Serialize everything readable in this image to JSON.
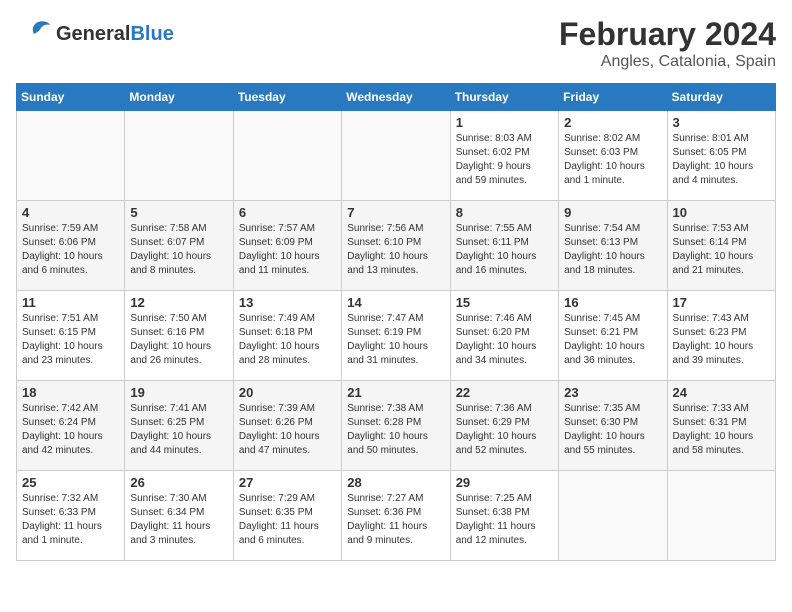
{
  "header": {
    "logo_general": "General",
    "logo_blue": "Blue",
    "month": "February 2024",
    "location": "Angles, Catalonia, Spain"
  },
  "days_of_week": [
    "Sunday",
    "Monday",
    "Tuesday",
    "Wednesday",
    "Thursday",
    "Friday",
    "Saturday"
  ],
  "weeks": [
    [
      {
        "day": "",
        "info": ""
      },
      {
        "day": "",
        "info": ""
      },
      {
        "day": "",
        "info": ""
      },
      {
        "day": "",
        "info": ""
      },
      {
        "day": "1",
        "info": "Sunrise: 8:03 AM\nSunset: 6:02 PM\nDaylight: 9 hours\nand 59 minutes."
      },
      {
        "day": "2",
        "info": "Sunrise: 8:02 AM\nSunset: 6:03 PM\nDaylight: 10 hours\nand 1 minute."
      },
      {
        "day": "3",
        "info": "Sunrise: 8:01 AM\nSunset: 6:05 PM\nDaylight: 10 hours\nand 4 minutes."
      }
    ],
    [
      {
        "day": "4",
        "info": "Sunrise: 7:59 AM\nSunset: 6:06 PM\nDaylight: 10 hours\nand 6 minutes."
      },
      {
        "day": "5",
        "info": "Sunrise: 7:58 AM\nSunset: 6:07 PM\nDaylight: 10 hours\nand 8 minutes."
      },
      {
        "day": "6",
        "info": "Sunrise: 7:57 AM\nSunset: 6:09 PM\nDaylight: 10 hours\nand 11 minutes."
      },
      {
        "day": "7",
        "info": "Sunrise: 7:56 AM\nSunset: 6:10 PM\nDaylight: 10 hours\nand 13 minutes."
      },
      {
        "day": "8",
        "info": "Sunrise: 7:55 AM\nSunset: 6:11 PM\nDaylight: 10 hours\nand 16 minutes."
      },
      {
        "day": "9",
        "info": "Sunrise: 7:54 AM\nSunset: 6:13 PM\nDaylight: 10 hours\nand 18 minutes."
      },
      {
        "day": "10",
        "info": "Sunrise: 7:53 AM\nSunset: 6:14 PM\nDaylight: 10 hours\nand 21 minutes."
      }
    ],
    [
      {
        "day": "11",
        "info": "Sunrise: 7:51 AM\nSunset: 6:15 PM\nDaylight: 10 hours\nand 23 minutes."
      },
      {
        "day": "12",
        "info": "Sunrise: 7:50 AM\nSunset: 6:16 PM\nDaylight: 10 hours\nand 26 minutes."
      },
      {
        "day": "13",
        "info": "Sunrise: 7:49 AM\nSunset: 6:18 PM\nDaylight: 10 hours\nand 28 minutes."
      },
      {
        "day": "14",
        "info": "Sunrise: 7:47 AM\nSunset: 6:19 PM\nDaylight: 10 hours\nand 31 minutes."
      },
      {
        "day": "15",
        "info": "Sunrise: 7:46 AM\nSunset: 6:20 PM\nDaylight: 10 hours\nand 34 minutes."
      },
      {
        "day": "16",
        "info": "Sunrise: 7:45 AM\nSunset: 6:21 PM\nDaylight: 10 hours\nand 36 minutes."
      },
      {
        "day": "17",
        "info": "Sunrise: 7:43 AM\nSunset: 6:23 PM\nDaylight: 10 hours\nand 39 minutes."
      }
    ],
    [
      {
        "day": "18",
        "info": "Sunrise: 7:42 AM\nSunset: 6:24 PM\nDaylight: 10 hours\nand 42 minutes."
      },
      {
        "day": "19",
        "info": "Sunrise: 7:41 AM\nSunset: 6:25 PM\nDaylight: 10 hours\nand 44 minutes."
      },
      {
        "day": "20",
        "info": "Sunrise: 7:39 AM\nSunset: 6:26 PM\nDaylight: 10 hours\nand 47 minutes."
      },
      {
        "day": "21",
        "info": "Sunrise: 7:38 AM\nSunset: 6:28 PM\nDaylight: 10 hours\nand 50 minutes."
      },
      {
        "day": "22",
        "info": "Sunrise: 7:36 AM\nSunset: 6:29 PM\nDaylight: 10 hours\nand 52 minutes."
      },
      {
        "day": "23",
        "info": "Sunrise: 7:35 AM\nSunset: 6:30 PM\nDaylight: 10 hours\nand 55 minutes."
      },
      {
        "day": "24",
        "info": "Sunrise: 7:33 AM\nSunset: 6:31 PM\nDaylight: 10 hours\nand 58 minutes."
      }
    ],
    [
      {
        "day": "25",
        "info": "Sunrise: 7:32 AM\nSunset: 6:33 PM\nDaylight: 11 hours\nand 1 minute."
      },
      {
        "day": "26",
        "info": "Sunrise: 7:30 AM\nSunset: 6:34 PM\nDaylight: 11 hours\nand 3 minutes."
      },
      {
        "day": "27",
        "info": "Sunrise: 7:29 AM\nSunset: 6:35 PM\nDaylight: 11 hours\nand 6 minutes."
      },
      {
        "day": "28",
        "info": "Sunrise: 7:27 AM\nSunset: 6:36 PM\nDaylight: 11 hours\nand 9 minutes."
      },
      {
        "day": "29",
        "info": "Sunrise: 7:25 AM\nSunset: 6:38 PM\nDaylight: 11 hours\nand 12 minutes."
      },
      {
        "day": "",
        "info": ""
      },
      {
        "day": "",
        "info": ""
      }
    ]
  ]
}
